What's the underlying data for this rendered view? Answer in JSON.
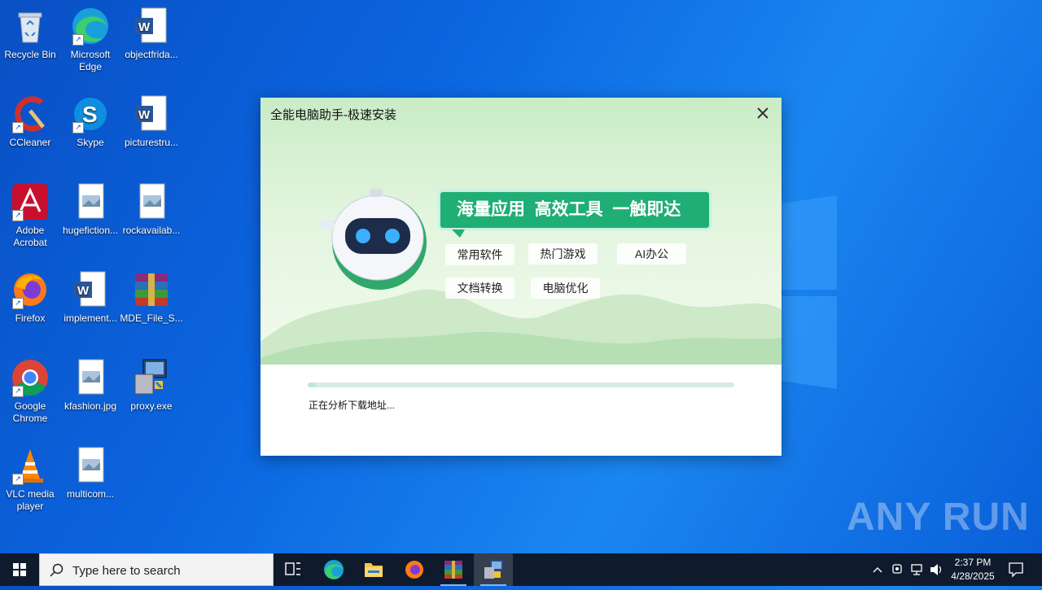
{
  "desktop": {
    "icons": [
      {
        "label": "Recycle Bin"
      },
      {
        "label": "Microsoft Edge"
      },
      {
        "label": "objectfrida..."
      },
      {
        "label": "CCleaner"
      },
      {
        "label": "Skype"
      },
      {
        "label": "picturestru..."
      },
      {
        "label": "Adobe Acrobat"
      },
      {
        "label": "hugefiction..."
      },
      {
        "label": "rockavailab..."
      },
      {
        "label": "Firefox"
      },
      {
        "label": "implement..."
      },
      {
        "label": "MDE_File_S..."
      },
      {
        "label": "Google Chrome"
      },
      {
        "label": "kfashion.jpg"
      },
      {
        "label": "proxy.exe"
      },
      {
        "label": "VLC media player"
      },
      {
        "label": "multicom..."
      }
    ]
  },
  "dialog": {
    "title": "全能电脑助手-极速安装",
    "slogan": "海量应用  高效工具  一触即达",
    "tags": [
      "常用软件",
      "热门游戏",
      "AI办公",
      "文档转换",
      "电脑优化"
    ],
    "status_text": "正在分析下载地址...",
    "progress": 0.02
  },
  "taskbar": {
    "search_placeholder": "Type here to search",
    "time": "2:37 PM",
    "date": "4/28/2025"
  },
  "watermark": "ANY RUN",
  "colors": {
    "slogan_green": "#1fae74",
    "taskbar": "#0f1b2d",
    "desktop_blue": "#0b66e0"
  }
}
